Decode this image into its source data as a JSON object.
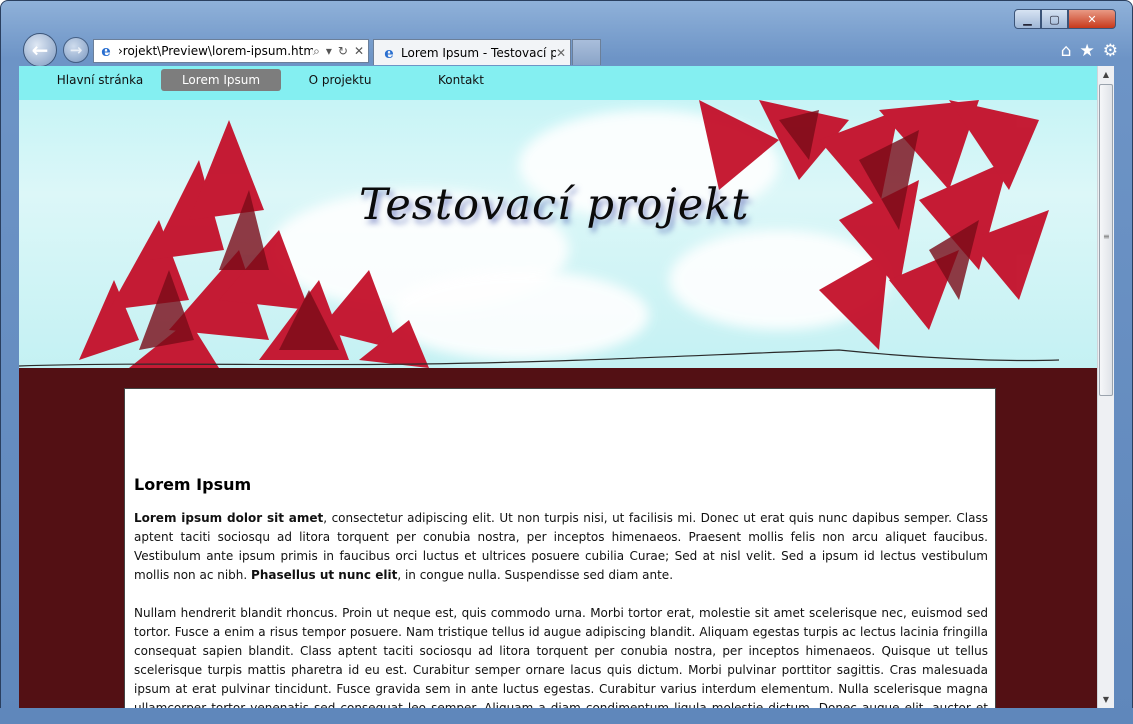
{
  "browser": {
    "address": "›rojekt\\Preview\\lorem-ipsum.html",
    "tab_title": "Lorem Ipsum - Testovací pr...",
    "icons": [
      "back-arrow-icon",
      "forward-arrow-icon",
      "ie-icon",
      "search-icon",
      "refresh-icon",
      "stop-icon",
      "home-icon",
      "favorites-star-icon",
      "tools-gear-icon"
    ]
  },
  "site": {
    "nav": [
      {
        "label": "Hlavní stránka",
        "active": false
      },
      {
        "label": "Lorem Ipsum",
        "active": true
      },
      {
        "label": "O projektu",
        "active": false
      },
      {
        "label": "Kontakt",
        "active": false
      }
    ],
    "title": "Testovací projekt",
    "colors": {
      "nav_bg": "#84eff1",
      "active_nav": "#7d7d7d",
      "page_bg": "#531014"
    }
  },
  "article": {
    "heading": "Lorem Ipsum",
    "p1_bold_start": "Lorem ipsum dolor sit amet",
    "p1_text": ", consectetur adipiscing elit. Ut non turpis nisi, ut facilisis mi. Donec ut erat quis nunc dapibus semper. Class aptent taciti sociosqu ad litora torquent per conubia nostra, per inceptos himenaeos. Praesent mollis felis non arcu aliquet faucibus. Vestibulum ante ipsum primis in faucibus orci luctus et ultrices posuere cubilia Curae; Sed at nisl velit. Sed a ipsum id lectus vestibulum mollis non ac nibh. ",
    "p1_bold_mid": "Phasellus ut nunc elit",
    "p1_text_end": ", in congue nulla. Suspendisse sed diam ante.",
    "p2": "Nullam hendrerit blandit rhoncus. Proin ut neque est, quis commodo urna. Morbi tortor erat, molestie sit amet scelerisque nec, euismod sed tortor. Fusce a enim a risus tempor posuere. Nam tristique tellus id augue adipiscing blandit. Aliquam egestas turpis ac lectus lacinia fringilla consequat sapien blandit. Class aptent taciti sociosqu ad litora torquent per conubia nostra, per inceptos himenaeos. Quisque ut tellus scelerisque turpis mattis pharetra id eu est. Curabitur semper ornare lacus quis dictum. Morbi pulvinar porttitor sagittis. Cras malesuada ipsum at erat pulvinar tincidunt. Fusce gravida sem in ante luctus egestas. Curabitur varius interdum elementum. Nulla scelerisque magna ullamcorper tortor venenatis sed consequat leo semper. Aliquam a diam condimentum ligula molestie dictum. Donec augue elit, auctor et tristique vel, bibendum quis quam."
  }
}
